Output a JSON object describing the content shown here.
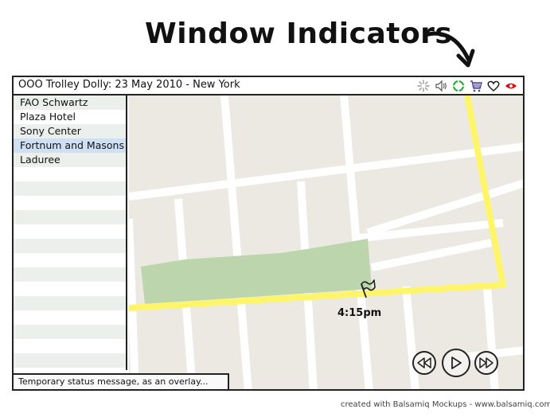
{
  "annotation": {
    "heading": "Window Indicators",
    "arrow_icon": "curved-arrow-down"
  },
  "window": {
    "title": "OOO Trolley Dolly: 23 May 2010 - New York",
    "indicators": [
      {
        "name": "loading-spinner",
        "color": "#888888"
      },
      {
        "name": "speaker",
        "color": "#555555"
      },
      {
        "name": "sync-circle",
        "color": "#1fae2a"
      },
      {
        "name": "shopping-cart",
        "color": "#4b3f8f"
      },
      {
        "name": "heart",
        "color": "#111111"
      },
      {
        "name": "eye",
        "color": "#e00000"
      }
    ]
  },
  "sidebar": {
    "items": [
      {
        "label": "FAO Schwartz",
        "selected": false
      },
      {
        "label": "Plaza Hotel",
        "selected": false
      },
      {
        "label": "Sony Center",
        "selected": false
      },
      {
        "label": "Fortnum and Masons",
        "selected": true
      },
      {
        "label": "Laduree",
        "selected": false
      }
    ],
    "empty_rows": 14
  },
  "map": {
    "marker_label": "4:15pm",
    "colors": {
      "land": "#ebe9e2",
      "road": "#ffffff",
      "route": "#fff56b",
      "park": "#bcd5ac"
    },
    "controls": {
      "rewind_icon": "rewind",
      "play_icon": "play",
      "fast_forward_icon": "fast-forward"
    }
  },
  "status_overlay": "Temporary status message, as an overlay...",
  "footer": "created with Balsamiq Mockups - www.balsamiq.com"
}
